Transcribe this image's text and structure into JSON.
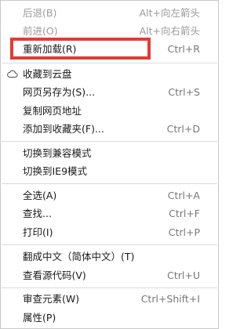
{
  "menu": {
    "items": [
      {
        "label": "后退(B)",
        "shortcut": "Alt+向左箭头",
        "disabled": true
      },
      {
        "label": "前进(O)",
        "shortcut": "Alt+向右箭头",
        "disabled": true
      },
      {
        "label": "重新加载(R)",
        "shortcut": "Ctrl+R",
        "disabled": false
      },
      {
        "label": "收藏到云盘",
        "shortcut": "",
        "disabled": false
      },
      {
        "label": "网页另存为(S)...",
        "shortcut": "Ctrl+S",
        "disabled": false
      },
      {
        "label": "复制网页地址",
        "shortcut": "",
        "disabled": false
      },
      {
        "label": "添加到收藏夹(F)...",
        "shortcut": "Ctrl+D",
        "disabled": false
      },
      {
        "label": "切换到兼容模式",
        "shortcut": "",
        "disabled": false
      },
      {
        "label": "切换到IE9模式",
        "shortcut": "",
        "disabled": false
      },
      {
        "label": "全选(A)",
        "shortcut": "Ctrl+A",
        "disabled": false
      },
      {
        "label": "查找...",
        "shortcut": "Ctrl+F",
        "disabled": false
      },
      {
        "label": "打印(I)",
        "shortcut": "Ctrl+P",
        "disabled": false
      },
      {
        "label": "翻成中文（简体中文）(T)",
        "shortcut": "",
        "disabled": false
      },
      {
        "label": "查看源代码(V)",
        "shortcut": "Ctrl+U",
        "disabled": false
      },
      {
        "label": "审查元素(W)",
        "shortcut": "Ctrl+Shift+I",
        "disabled": false
      },
      {
        "label": "属性(P)",
        "shortcut": "",
        "disabled": false
      }
    ]
  },
  "colors": {
    "highlight_border": "#e53935",
    "disabled_text": "#9a9a9a",
    "separator": "#dadada"
  },
  "icons": {
    "save_to_cloud": "cloud-icon"
  }
}
